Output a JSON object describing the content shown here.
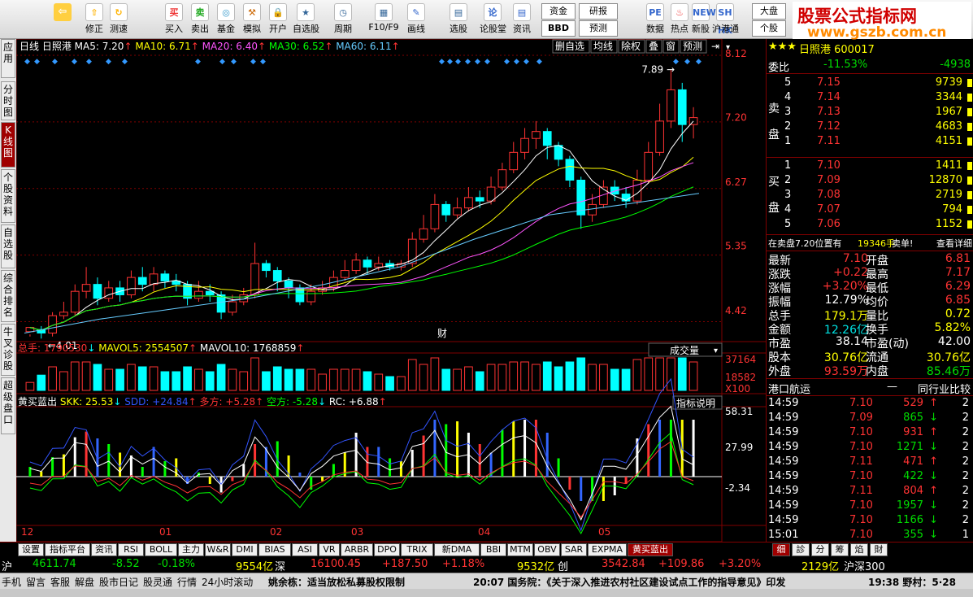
{
  "toolbar": {
    "buttons": [
      {
        "label": "修正",
        "icon": "arrow-up-icon"
      },
      {
        "label": "测速",
        "icon": "speed-icon"
      },
      {
        "label": "买入",
        "icon": "buy-icon"
      },
      {
        "label": "卖出",
        "icon": "sell-icon"
      },
      {
        "label": "基金",
        "icon": "fund-icon"
      },
      {
        "label": "模拟",
        "icon": "hammer-icon"
      },
      {
        "label": "开户",
        "icon": "lock-icon"
      },
      {
        "label": "自选股",
        "icon": "star-icon"
      },
      {
        "label": "周期",
        "icon": "clock-icon"
      },
      {
        "label": "F10/F9",
        "icon": "f10-icon"
      },
      {
        "label": "画线",
        "icon": "pen-icon"
      },
      {
        "label": "选股",
        "icon": "filter-icon"
      },
      {
        "label": "论股堂",
        "icon": "forum-icon"
      },
      {
        "label": "资讯",
        "icon": "news-icon"
      },
      {
        "label": "数据",
        "icon": "pe-icon"
      },
      {
        "label": "热点",
        "icon": "hot-icon"
      },
      {
        "label": "新股",
        "icon": "ipo-icon"
      },
      {
        "label": "沪港通",
        "icon": "shhk-icon"
      }
    ],
    "icon_glyphs": {
      "buy": "买",
      "sell": "卖",
      "fund": "◎",
      "ipo": "NEW",
      "shhk": "SH HK",
      "bbd": "BBD"
    },
    "boxes": {
      "fund_flow": "资金",
      "research": "研报",
      "bbd": "BBD",
      "predict": "预测",
      "market": "大盘",
      "stock": "个股"
    }
  },
  "brand": {
    "title": "股票公式指标网",
    "url": "www.gszb.com.cn"
  },
  "left_tabs": [
    "应用",
    "分时图",
    "K线图",
    "个股资料",
    "自选股",
    "综合排名",
    "牛叉诊股",
    "超级盘口"
  ],
  "chart": {
    "period": "日线",
    "stock_name": "日照港",
    "ma_labels": [
      {
        "name": "MA5",
        "value": "7.20",
        "color": "#ffffff"
      },
      {
        "name": "MA10",
        "value": "6.71",
        "color": "#ffff00"
      },
      {
        "name": "MA20",
        "value": "6.40",
        "color": "#ff55ff"
      },
      {
        "name": "MA30",
        "value": "6.52",
        "color": "#00ff00"
      },
      {
        "name": "MA60",
        "value": "6.11",
        "color": "#66ccff"
      }
    ],
    "top_buttons": [
      "删自选",
      "均线",
      "除权",
      "叠",
      "窗",
      "预测"
    ],
    "price_axis": [
      "8.12",
      "7.20",
      "6.27",
      "5.35",
      "4.42"
    ],
    "high_label": "7.89",
    "low_label": "4.01",
    "cai_marker": "财",
    "month_labels": [
      "12",
      "01",
      "02",
      "03",
      "04",
      "05"
    ],
    "volume_header": {
      "total": "总手: 1790530",
      "mavol5": "MAVOL5: 2554507",
      "mavol10": "MAVOL10: 1768859"
    },
    "volume_dropdown": "成交量",
    "volume_axis": [
      "37164",
      "18582",
      "X100"
    ],
    "indicator_header": {
      "name": "黄买蓝出",
      "skk": "SKK: 25.53",
      "sdd": "SDD: +24.84",
      "duo": "多方: +5.28",
      "kong": "空方: -5.28",
      "rc": "RC: +6.88"
    },
    "indicator_button": "指标说明",
    "indicator_axis": [
      "58.31",
      "27.99",
      "-2.34"
    ],
    "colors": {
      "up": "#ff3333",
      "down": "#00ffff",
      "grid": "#800000"
    }
  },
  "chart_data": {
    "type": "candlestick",
    "title": "日照港 日线",
    "x": [
      "12",
      "01",
      "02",
      "03",
      "04",
      "05"
    ],
    "ylim": [
      4.0,
      8.12
    ],
    "series": [
      {
        "name": "MA5",
        "values": [
          4.15,
          4.6,
          4.8,
          4.75,
          5.0,
          5.55,
          6.5,
          6.8,
          6.4,
          7.2
        ]
      },
      {
        "name": "MA60",
        "values": [
          4.1,
          4.3,
          4.45,
          4.6,
          4.8,
          5.05,
          5.45,
          5.8,
          5.95,
          6.11
        ]
      }
    ],
    "high": 7.89,
    "low": 4.01,
    "candles": [
      [
        4.12,
        4.18,
        4.08,
        4.05
      ],
      [
        4.15,
        4.1,
        4.2,
        4.02
      ],
      [
        4.1,
        4.35,
        4.4,
        4.05
      ],
      [
        4.35,
        4.4,
        4.55,
        4.3
      ],
      [
        4.4,
        4.7,
        4.8,
        4.35
      ],
      [
        4.7,
        4.8,
        5.05,
        4.6
      ],
      [
        4.8,
        4.6,
        4.9,
        4.5
      ],
      [
        4.6,
        4.75,
        4.85,
        4.55
      ],
      [
        4.75,
        4.65,
        4.85,
        4.55
      ],
      [
        4.65,
        4.9,
        5.0,
        4.6
      ],
      [
        4.9,
        4.8,
        5.05,
        4.7
      ],
      [
        4.8,
        4.95,
        5.05,
        4.7
      ],
      [
        4.95,
        4.85,
        5.0,
        4.75
      ],
      [
        4.85,
        4.8,
        4.95,
        4.7
      ],
      [
        4.8,
        4.6,
        4.85,
        4.5
      ],
      [
        4.6,
        4.7,
        4.85,
        4.55
      ],
      [
        4.7,
        4.65,
        4.8,
        4.55
      ],
      [
        4.65,
        4.4,
        4.7,
        4.3
      ],
      [
        4.4,
        4.55,
        4.65,
        4.35
      ],
      [
        4.55,
        4.65,
        4.75,
        4.5
      ],
      [
        4.65,
        5.1,
        5.4,
        4.6
      ],
      [
        5.1,
        5.0,
        5.15,
        4.9
      ],
      [
        5.0,
        4.85,
        5.05,
        4.7
      ],
      [
        4.85,
        4.75,
        4.9,
        4.6
      ],
      [
        4.75,
        4.55,
        4.8,
        4.5
      ],
      [
        4.55,
        4.7,
        4.8,
        4.5
      ],
      [
        4.7,
        4.75,
        4.85,
        4.65
      ],
      [
        4.75,
        4.9,
        5.0,
        4.7
      ],
      [
        4.9,
        5.0,
        5.15,
        4.85
      ],
      [
        5.0,
        5.15,
        5.25,
        4.95
      ],
      [
        5.15,
        5.05,
        5.2,
        4.95
      ],
      [
        5.05,
        5.1,
        5.2,
        5.0
      ],
      [
        5.1,
        5.05,
        5.15,
        5.0
      ],
      [
        5.05,
        5.1,
        5.15,
        5.0
      ],
      [
        5.1,
        5.45,
        5.55,
        5.05
      ],
      [
        5.45,
        5.6,
        5.8,
        5.4
      ],
      [
        5.6,
        5.95,
        6.1,
        5.55
      ],
      [
        5.95,
        5.8,
        6.0,
        5.7
      ],
      [
        5.8,
        5.9,
        6.05,
        5.75
      ],
      [
        5.9,
        6.05,
        6.2,
        5.85
      ],
      [
        6.05,
        6.0,
        6.15,
        5.9
      ],
      [
        6.0,
        6.2,
        6.35,
        5.95
      ],
      [
        6.2,
        6.45,
        6.55,
        6.15
      ],
      [
        6.45,
        6.7,
        6.85,
        6.4
      ],
      [
        6.7,
        6.9,
        7.05,
        6.6
      ],
      [
        6.9,
        7.0,
        7.15,
        6.75
      ],
      [
        7.0,
        6.8,
        7.05,
        6.6
      ],
      [
        6.8,
        6.6,
        6.85,
        6.5
      ],
      [
        6.6,
        6.3,
        6.65,
        6.2
      ],
      [
        6.3,
        5.8,
        6.35,
        5.6
      ],
      [
        5.8,
        5.95,
        6.1,
        5.7
      ],
      [
        5.95,
        6.2,
        6.3,
        5.9
      ],
      [
        6.2,
        6.1,
        6.3,
        6.0
      ],
      [
        6.1,
        6.0,
        6.2,
        5.9
      ],
      [
        6.0,
        6.3,
        6.45,
        5.95
      ],
      [
        6.3,
        6.7,
        6.85,
        6.25
      ],
      [
        6.7,
        7.15,
        7.4,
        6.65
      ],
      [
        7.15,
        7.6,
        7.89,
        7.05
      ],
      [
        7.6,
        7.1,
        7.7,
        6.85
      ],
      [
        7.1,
        7.2,
        7.35,
        6.9
      ]
    ],
    "volume_series": [
      {
        "name": "MAVOL5",
        "value": 2554507
      },
      {
        "name": "MAVOL10",
        "value": 1768859
      }
    ],
    "volume_total": 1790530
  },
  "right": {
    "header_stars": "★★★",
    "header_name": "日照港 600017",
    "weibi": {
      "label": "委比",
      "value": "-11.53%",
      "diff": "-4938"
    },
    "sell_label": [
      "卖",
      "盘"
    ],
    "buy_label": [
      "买",
      "盘"
    ],
    "sell": [
      {
        "lvl": "5",
        "price": "7.15",
        "vol": "9739"
      },
      {
        "lvl": "4",
        "price": "7.14",
        "vol": "3344"
      },
      {
        "lvl": "3",
        "price": "7.13",
        "vol": "1967"
      },
      {
        "lvl": "2",
        "price": "7.12",
        "vol": "4683"
      },
      {
        "lvl": "1",
        "price": "7.11",
        "vol": "4151"
      }
    ],
    "buy": [
      {
        "lvl": "1",
        "price": "7.10",
        "vol": "1411"
      },
      {
        "lvl": "2",
        "price": "7.09",
        "vol": "12870"
      },
      {
        "lvl": "3",
        "price": "7.08",
        "vol": "2719"
      },
      {
        "lvl": "4",
        "price": "7.07",
        "vol": "794"
      },
      {
        "lvl": "5",
        "price": "7.06",
        "vol": "1152"
      }
    ],
    "notice": {
      "text": "在卖盘7.20位置有",
      "vol": "19346手",
      "tail": "卖单!",
      "link": "查看详细"
    },
    "stats": [
      {
        "l1": "最新",
        "v1": "7.10",
        "l2": "开盘",
        "v2": "6.81",
        "c1": "red",
        "c2": "red"
      },
      {
        "l1": "涨跌",
        "v1": "+0.22",
        "l2": "最高",
        "v2": "7.17",
        "c1": "red",
        "c2": "red"
      },
      {
        "l1": "涨幅",
        "v1": "+3.20%",
        "l2": "最低",
        "v2": "6.29",
        "c1": "red",
        "c2": "red"
      },
      {
        "l1": "振幅",
        "v1": "12.79%",
        "l2": "均价",
        "v2": "6.85",
        "c1": "wht",
        "c2": "red"
      },
      {
        "l1": "总手",
        "v1": "179.1万",
        "l2": "量比",
        "v2": "0.72",
        "c1": "yel",
        "c2": "yel"
      },
      {
        "l1": "金额",
        "v1": "12.26亿",
        "l2": "换手",
        "v2": "5.82%",
        "c1": "cy",
        "c2": "yel"
      },
      {
        "l1": "市盈",
        "v1": "38.14",
        "l2": "市盈(动)",
        "v2": "42.00",
        "c1": "wht",
        "c2": "wht"
      },
      {
        "l1": "股本",
        "v1": "30.76亿",
        "l2": "流通",
        "v2": "30.76亿",
        "c1": "yel",
        "c2": "yel"
      },
      {
        "l1": "外盘",
        "v1": "93.59万",
        "l2": "内盘",
        "v2": "85.46万",
        "c1": "red",
        "c2": "grn"
      }
    ],
    "industry": {
      "name": "港口航运",
      "link": "同行业比较"
    },
    "ticks": [
      {
        "time": "14:59",
        "price": "7.10",
        "vol": "529",
        "dir": "up",
        "n": "2"
      },
      {
        "time": "14:59",
        "price": "7.09",
        "vol": "865",
        "dir": "down",
        "n": "2"
      },
      {
        "time": "14:59",
        "price": "7.10",
        "vol": "931",
        "dir": "up",
        "n": "2"
      },
      {
        "time": "14:59",
        "price": "7.10",
        "vol": "1271",
        "dir": "down",
        "n": "2"
      },
      {
        "time": "14:59",
        "price": "7.11",
        "vol": "471",
        "dir": "up",
        "n": "2"
      },
      {
        "time": "14:59",
        "price": "7.10",
        "vol": "422",
        "dir": "down",
        "n": "2"
      },
      {
        "time": "14:59",
        "price": "7.11",
        "vol": "804",
        "dir": "up",
        "n": "2"
      },
      {
        "time": "14:59",
        "price": "7.10",
        "vol": "1957",
        "dir": "down",
        "n": "2"
      },
      {
        "time": "14:59",
        "price": "7.10",
        "vol": "1166",
        "dir": "down",
        "n": "2"
      },
      {
        "time": "15:01",
        "price": "7.10",
        "vol": "355",
        "dir": "down",
        "n": "1"
      }
    ],
    "bottom_tabs": [
      "细",
      "診",
      "分",
      "筹",
      "焰",
      "財"
    ]
  },
  "bottom_tabs": [
    "设置",
    "指标平台",
    "资讯",
    "RSI",
    "BOLL",
    "主力",
    "W&R",
    "DMI",
    "BIAS",
    "ASI",
    "VR",
    "ARBR",
    "DPO",
    "TRIX",
    "新DMA",
    "BBI",
    "MTM",
    "OBV",
    "SAR",
    "EXPMA",
    "黄买蓝出"
  ],
  "index_bar": {
    "sh_label": "沪",
    "sh_val": "4611.74",
    "sh_chg": "-8.52",
    "sh_pct": "-0.18%",
    "sh_amt": "9554亿",
    "sz_label": "深",
    "sz_val": "16100.45",
    "sz_chg": "+187.50",
    "sz_pct": "+1.18%",
    "sz_amt": "9532亿",
    "cy_label": "创",
    "cy_val": "3542.84",
    "cy_chg": "+109.86",
    "cy_pct": "+3.20%",
    "cy_amt": "2129亿",
    "hs_label": "沪深300"
  },
  "status": {
    "items": [
      "手机",
      "留言",
      "客服",
      "解盘",
      "股市日记",
      "股灵通",
      "行情",
      "24小时滚动"
    ],
    "news1": "姚余栋：适当放松私募股权限制",
    "news2": "20:07 国务院：《关于深入推进农村社区建设试点工作的指导意见》印发",
    "news3": "19:38 野村：5·28"
  }
}
